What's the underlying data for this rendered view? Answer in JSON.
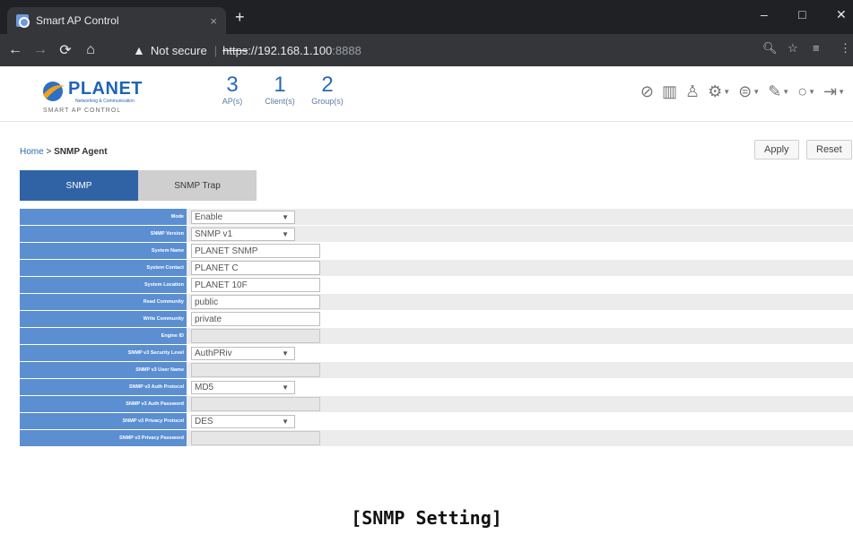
{
  "browser": {
    "tab_title": "Smart AP Control",
    "tab_close": "×",
    "new_tab": "+",
    "security_warning": "Not secure",
    "url_scheme": "https",
    "url_sep": "://",
    "url_host": "192.168.1.100",
    "url_port": ":8888",
    "window_controls": [
      "–",
      "□",
      "✕"
    ]
  },
  "header": {
    "logo_text": "PLANET",
    "logo_tagline": "Networking & Communication",
    "logo_sub": "SMART AP CONTROL",
    "stats": [
      {
        "value": "3",
        "label": "AP(s)"
      },
      {
        "value": "1",
        "label": "Client(s)"
      },
      {
        "value": "2",
        "label": "Group(s)"
      }
    ],
    "toolbar_icons": [
      "dashboard-icon",
      "chart-icon",
      "users-icon",
      "gear-icon",
      "globe-icon",
      "wrench-icon",
      "refresh-icon",
      "logout-icon"
    ]
  },
  "breadcrumb": {
    "home": "Home",
    "separator": " > ",
    "current": "SNMP Agent"
  },
  "actions": {
    "apply": "Apply",
    "reset": "Reset"
  },
  "tabs": [
    {
      "label": "SNMP",
      "active": true
    },
    {
      "label": "SNMP Trap",
      "active": false
    }
  ],
  "form": {
    "rows": [
      {
        "label": "Mode",
        "type": "select",
        "value": "Enable"
      },
      {
        "label": "SNMP Version",
        "type": "select",
        "value": "SNMP v1"
      },
      {
        "label": "System Name",
        "type": "input",
        "value": "PLANET SNMP"
      },
      {
        "label": "System Contact",
        "type": "input",
        "value": "PLANET C"
      },
      {
        "label": "System Location",
        "type": "input",
        "value": "PLANET 10F"
      },
      {
        "label": "Read Community",
        "type": "input",
        "value": "public"
      },
      {
        "label": "Write Community",
        "type": "input",
        "value": "private"
      },
      {
        "label": "Engine ID",
        "type": "input-disabled",
        "value": ""
      },
      {
        "label": "SNMP v3 Security Level",
        "type": "select",
        "value": "AuthPRiv"
      },
      {
        "label": "SNMP v3 User Name",
        "type": "input-disabled",
        "value": ""
      },
      {
        "label": "SNMP v3 Auth Protocol",
        "type": "select",
        "value": "MD5"
      },
      {
        "label": "SNMP v3 Auth Password",
        "type": "input-disabled",
        "value": ""
      },
      {
        "label": "SNMP v3 Privacy Protocol",
        "type": "select",
        "value": "DES"
      },
      {
        "label": "SNMP v3 Privacy Password",
        "type": "input-disabled",
        "value": ""
      }
    ]
  },
  "caption": "[SNMP Setting]"
}
